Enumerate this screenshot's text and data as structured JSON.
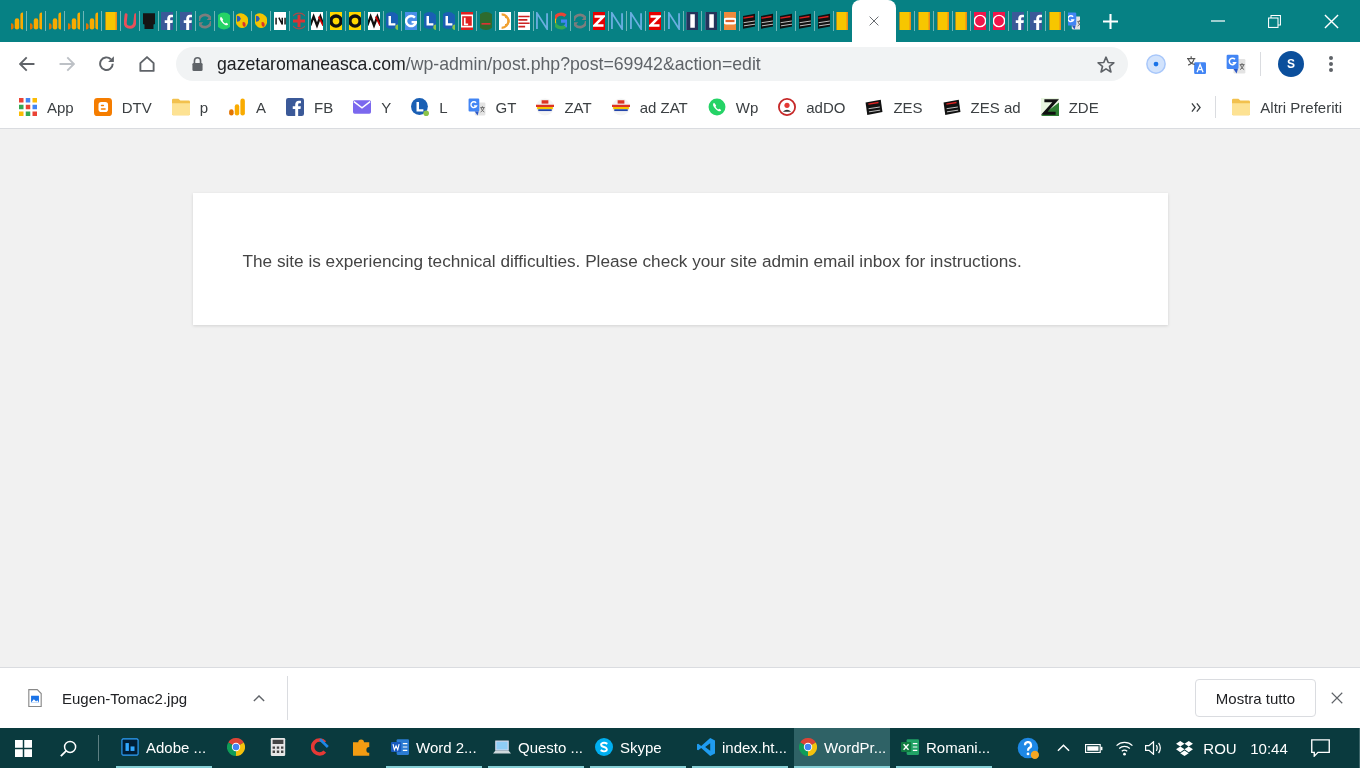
{
  "tab_strip": {
    "tabs": [
      {
        "kind": "analytics",
        "selected": false
      },
      {
        "kind": "analytics",
        "selected": false
      },
      {
        "kind": "analytics",
        "selected": false
      },
      {
        "kind": "analytics",
        "selected": false
      },
      {
        "kind": "analytics",
        "selected": false
      },
      {
        "kind": "flag",
        "selected": false
      },
      {
        "kind": "curve",
        "selected": false
      },
      {
        "kind": "helmet",
        "selected": false
      },
      {
        "kind": "facebook",
        "selected": false
      },
      {
        "kind": "facebook",
        "selected": false
      },
      {
        "kind": "swirl",
        "selected": false
      },
      {
        "kind": "whatsapp",
        "selected": false
      },
      {
        "kind": "map",
        "selected": false
      },
      {
        "kind": "map",
        "selected": false
      },
      {
        "kind": "newsprint",
        "selected": false
      },
      {
        "kind": "cross",
        "selected": false
      },
      {
        "kind": "monogram",
        "selected": false
      },
      {
        "kind": "coin",
        "selected": false
      },
      {
        "kind": "coin",
        "selected": false
      },
      {
        "kind": "monogram",
        "selected": false
      },
      {
        "kind": "lcircle",
        "selected": false
      },
      {
        "kind": "gtile",
        "selected": false
      },
      {
        "kind": "lcircle",
        "selected": false
      },
      {
        "kind": "lcircle",
        "selected": false
      },
      {
        "kind": "redtile",
        "selected": false
      },
      {
        "kind": "greendisc",
        "selected": false
      },
      {
        "kind": "crescent",
        "selected": false
      },
      {
        "kind": "leaflet",
        "selected": false
      },
      {
        "kind": "nslash",
        "selected": false
      },
      {
        "kind": "gcolor",
        "selected": false
      },
      {
        "kind": "swirl",
        "selected": false
      },
      {
        "kind": "ztile",
        "selected": false
      },
      {
        "kind": "nslash",
        "selected": false
      },
      {
        "kind": "nslash",
        "selected": false
      },
      {
        "kind": "ztile",
        "selected": false
      },
      {
        "kind": "nslash",
        "selected": false
      },
      {
        "kind": "pillar",
        "selected": false
      },
      {
        "kind": "pillar",
        "selected": false
      },
      {
        "kind": "orangetile",
        "selected": false
      },
      {
        "kind": "blackcard",
        "selected": false
      },
      {
        "kind": "blackcard",
        "selected": false
      },
      {
        "kind": "blackcard",
        "selected": false
      },
      {
        "kind": "blackcard",
        "selected": false
      },
      {
        "kind": "blackcard",
        "selected": false
      },
      {
        "kind": "flag",
        "selected": false
      },
      {
        "selected": true
      },
      {
        "kind": "flag",
        "selected": false
      },
      {
        "kind": "flag",
        "selected": false
      },
      {
        "kind": "flag",
        "selected": false
      },
      {
        "kind": "flag",
        "selected": false
      },
      {
        "kind": "redring",
        "selected": false
      },
      {
        "kind": "redring",
        "selected": false
      },
      {
        "kind": "facebook",
        "selected": false
      },
      {
        "kind": "facebook",
        "selected": false
      },
      {
        "kind": "flag",
        "selected": false
      },
      {
        "kind": "translate",
        "selected": false
      }
    ]
  },
  "toolbar": {
    "nav_buttons": [
      {
        "kind": "back",
        "disabled": false
      },
      {
        "kind": "forward",
        "disabled": true
      },
      {
        "kind": "reload",
        "disabled": false
      },
      {
        "kind": "home",
        "disabled": false
      }
    ],
    "address": {
      "host": "gazetaromaneasca.com",
      "path": "/wp-admin/post.php?post=69942&action=edit"
    },
    "profile": {
      "initial": "S"
    }
  },
  "bookmarks_bar": {
    "items": [
      {
        "label": "App",
        "kind": "apps"
      },
      {
        "label": "DTV",
        "kind": "blogger"
      },
      {
        "label": "p",
        "kind": "folder"
      },
      {
        "label": "A",
        "kind": "analytics"
      },
      {
        "label": "FB",
        "kind": "facebook"
      },
      {
        "label": "Y",
        "kind": "mail"
      },
      {
        "label": "L",
        "kind": "lcircle"
      },
      {
        "label": "GT",
        "kind": "translate"
      },
      {
        "label": "ZAT",
        "kind": "emblem"
      },
      {
        "label": "ad ZAT",
        "kind": "emblem"
      },
      {
        "label": "Wp",
        "kind": "whatsapp"
      },
      {
        "label": "adDO",
        "kind": "seal"
      },
      {
        "label": "ZES",
        "kind": "blackcard"
      },
      {
        "label": "ZES ad",
        "kind": "blackcard"
      },
      {
        "label": "ZDE",
        "kind": "zgreen"
      }
    ],
    "other": {
      "label": "Altri Preferiti",
      "kind": "folder"
    }
  },
  "page": {
    "message": "The site is experiencing technical difficulties. Please check your site admin email inbox for instructions."
  },
  "download_bar": {
    "downloads": [
      {
        "file_name": "Eugen-Tomac2.jpg"
      }
    ],
    "show_all_label": "Mostra tutto"
  },
  "taskbar": {
    "items": [
      {
        "kind": "photoshop",
        "label": "Adobe ...",
        "running": true,
        "selected": false
      },
      {
        "kind": "chrome",
        "running": false,
        "selected": false
      },
      {
        "kind": "calculator",
        "running": false,
        "selected": false
      },
      {
        "kind": "cleaner",
        "running": false,
        "selected": false
      },
      {
        "kind": "puzzle",
        "running": false,
        "selected": false
      },
      {
        "kind": "word",
        "label": "Word 2...",
        "running": true,
        "selected": false
      },
      {
        "kind": "explorer",
        "label": "Questo ...",
        "running": true,
        "selected": false
      },
      {
        "kind": "skype",
        "label": "Skype",
        "running": true,
        "selected": false
      },
      {
        "kind": "vscode",
        "label": "index.ht...",
        "running": true,
        "selected": false
      },
      {
        "kind": "chrome",
        "label": "WordPr...",
        "running": true,
        "selected": true
      },
      {
        "kind": "excel",
        "label": "Romani...",
        "running": true,
        "selected": false
      }
    ],
    "tray": {
      "language": "ROU",
      "time": "10:44"
    }
  }
}
